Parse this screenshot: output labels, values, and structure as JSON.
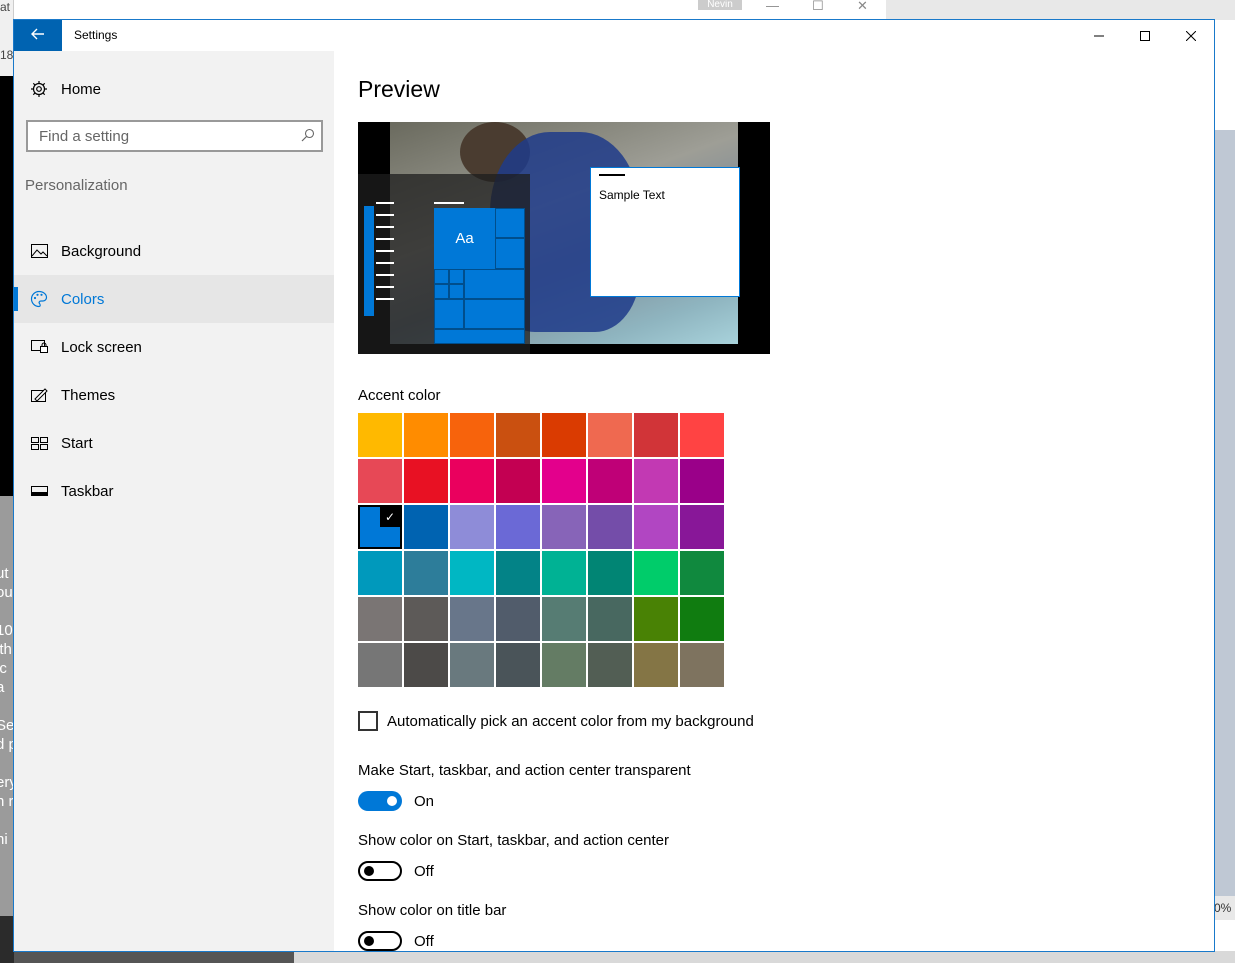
{
  "background_apps": {
    "left_fragment_top": [
      "at",
      "18"
    ],
    "left_fragment_lines": [
      "ut",
      "ou",
      "",
      "10",
      "ith",
      "ic",
      "a",
      "",
      "Se",
      "d p",
      "",
      "ery",
      "n r",
      "",
      "ni"
    ],
    "top_tag": "Nevin",
    "right_fragment_pct": "0%"
  },
  "window": {
    "title": "Settings",
    "back_icon": "back-arrow-icon",
    "controls": [
      "minimize",
      "maximize",
      "close"
    ]
  },
  "sidebar": {
    "home_label": "Home",
    "search_placeholder": "Find a setting",
    "section_title": "Personalization",
    "items": [
      {
        "label": "Background",
        "icon": "picture-icon",
        "selected": false
      },
      {
        "label": "Colors",
        "icon": "palette-icon",
        "selected": true
      },
      {
        "label": "Lock screen",
        "icon": "lock-screen-icon",
        "selected": false
      },
      {
        "label": "Themes",
        "icon": "themes-icon",
        "selected": false
      },
      {
        "label": "Start",
        "icon": "start-tiles-icon",
        "selected": false
      },
      {
        "label": "Taskbar",
        "icon": "taskbar-icon",
        "selected": false
      }
    ]
  },
  "main": {
    "preview_title": "Preview",
    "preview_tile_text": "Aa",
    "preview_sample_text": "Sample Text",
    "accent_title": "Accent color",
    "accent_colors": [
      "#ffb900",
      "#ff8c00",
      "#f7630c",
      "#ca5010",
      "#da3b01",
      "#ef6950",
      "#d13438",
      "#ff4343",
      "#e74856",
      "#e81123",
      "#ea005e",
      "#c30052",
      "#e3008c",
      "#bf0077",
      "#c239b3",
      "#9a0089",
      "#0078d7",
      "#0063b1",
      "#8e8cd8",
      "#6b69d6",
      "#8764b8",
      "#744da9",
      "#b146c2",
      "#881798",
      "#0099bc",
      "#2d7d9a",
      "#00b7c3",
      "#038387",
      "#00b294",
      "#018574",
      "#00cc6a",
      "#10893e",
      "#7a7574",
      "#5d5a58",
      "#68768a",
      "#515c6b",
      "#567c73",
      "#486860",
      "#498205",
      "#107c10",
      "#767676",
      "#4c4a48",
      "#69797e",
      "#4a5459",
      "#647c64",
      "#525e54",
      "#847545",
      "#7e735f"
    ],
    "selected_accent": "#0078d7",
    "auto_pick_label": "Automatically pick an accent color from my background",
    "auto_pick_checked": false,
    "transparent_label": "Make Start, taskbar, and action center transparent",
    "transparent_state": "On",
    "show_color_start_label": "Show color on Start, taskbar, and action center",
    "show_color_start_state": "Off",
    "show_color_title_label": "Show color on title bar",
    "show_color_title_state": "Off"
  },
  "colors": {
    "accent": "#0078d7",
    "back_button": "#0063b1",
    "sidebar_bg": "#f2f2f2"
  }
}
